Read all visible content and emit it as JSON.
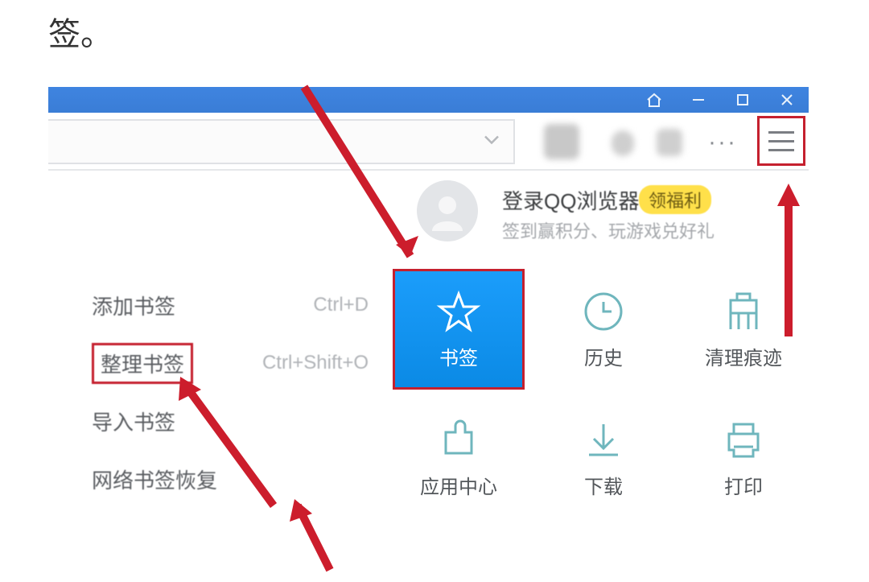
{
  "page_fragment": "签。",
  "window": {
    "title_bar_color": "#3f84e0"
  },
  "toolbar": {
    "more_glyph": "···"
  },
  "menu": {
    "login_title": "登录QQ浏览器",
    "login_badge": "领福利",
    "login_sub": "签到赢积分、玩游戏兑好礼",
    "cells": {
      "bookmark": "书签",
      "history": "历史",
      "clean": "清理痕迹",
      "apps": "应用中心",
      "download": "下载",
      "print": "打印"
    }
  },
  "submenu": {
    "add": {
      "label": "添加书签",
      "shortcut": "Ctrl+D"
    },
    "organize": {
      "label": "整理书签",
      "shortcut": "Ctrl+Shift+O"
    },
    "import": {
      "label": "导入书签"
    },
    "restore": {
      "label": "网络书签恢复"
    }
  }
}
